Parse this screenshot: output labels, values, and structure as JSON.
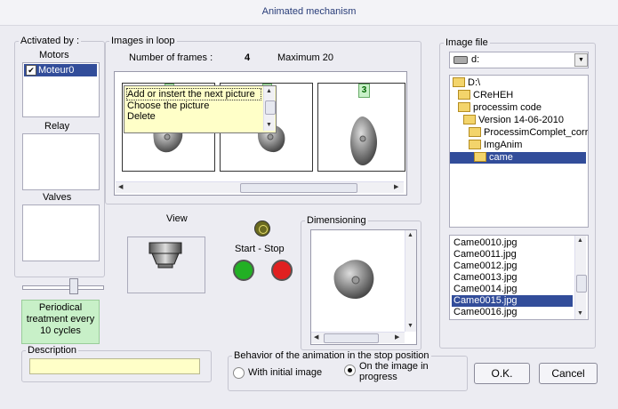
{
  "window": {
    "title": "Animated mechanism"
  },
  "activated": {
    "legend": "Activated by :",
    "motors_label": "Motors",
    "motor_item": "Moteur0",
    "relay_label": "Relay",
    "valves_label": "Valves",
    "slider_level": 0.65
  },
  "periodical": {
    "line1": "Periodical",
    "line2": "treatment every",
    "line3": "10 cycles"
  },
  "description": {
    "legend": "Description",
    "value": ""
  },
  "loop": {
    "legend": "Images in loop",
    "frames_label": "Number of frames :",
    "frames_value": "4",
    "maximum_text": "Maximum 20",
    "frame_badge_3": "3",
    "menu": [
      "Add or instert the next picture",
      "Choose the picture",
      "Delete"
    ]
  },
  "view": {
    "label": "View",
    "start_stop": "Start  -  Stop"
  },
  "dimensioning": {
    "legend": "Dimensioning"
  },
  "behavior": {
    "legend": "Behavior of the animation in the stop position",
    "option1": "With initial image",
    "option2_line1": "On the image in",
    "option2_line2": "progress",
    "selected": 2
  },
  "image_file": {
    "legend": "Image file",
    "drive": "d:",
    "tree": [
      "D:\\",
      "CReHEH",
      "processim code",
      "Version 14-06-2010",
      "ProcessimComplet_corrige",
      "ImgAnim",
      "came"
    ],
    "selected_folder": "came",
    "files": [
      "Came0010.jpg",
      "Came0011.jpg",
      "Came0012.jpg",
      "Came0013.jpg",
      "Came0014.jpg",
      "Came0015.jpg",
      "Came0016.jpg"
    ],
    "selected_file": "Came0015.jpg"
  },
  "buttons": {
    "ok": "O.K.",
    "cancel": "Cancel"
  },
  "colors": {
    "selection": "#324d9a",
    "note_yellow": "#ffffc8",
    "start_green": "#22b024",
    "stop_red": "#e02020",
    "periodical_green": "#c8f0c8"
  }
}
